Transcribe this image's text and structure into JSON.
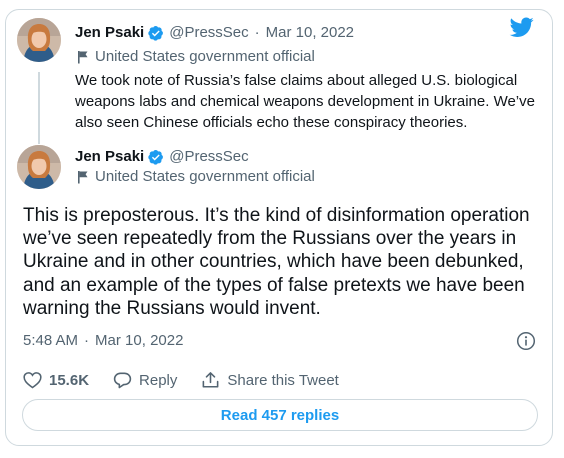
{
  "brand": {
    "accent": "#1d9bf0",
    "verified_color": "#1d9bf0",
    "muted": "#536471"
  },
  "quoted_tweet": {
    "author_name": "Jen Psaki",
    "handle": "@PressSec",
    "separator": "·",
    "date": "Mar 10, 2022",
    "account_label": "United States government official",
    "text": "We took note of Russia’s false claims about alleged U.S. biological weapons labs and chemical weapons development in Ukraine. We’ve also seen Chinese officials echo these conspiracy theories."
  },
  "main_tweet": {
    "author_name": "Jen Psaki",
    "handle": "@PressSec",
    "account_label": "United States government official",
    "text": "This is preposterous. It’s the kind of disinformation operation we’ve seen repeatedly from the Russians over the years in Ukraine and in other countries, which have been debunked, and an example of the types of false pretexts we have been warning the Russians would invent.",
    "time": "5:48 AM",
    "separator": "·",
    "date": "Mar 10, 2022"
  },
  "actions": {
    "like_count": "15.6K",
    "reply_label": "Reply",
    "share_label": "Share this Tweet"
  },
  "read_replies_label": "Read 457 replies",
  "icons": [
    "twitter-bird-icon",
    "verified-badge-icon",
    "flag-icon",
    "info-icon",
    "heart-icon",
    "reply-bubble-icon",
    "share-icon"
  ]
}
